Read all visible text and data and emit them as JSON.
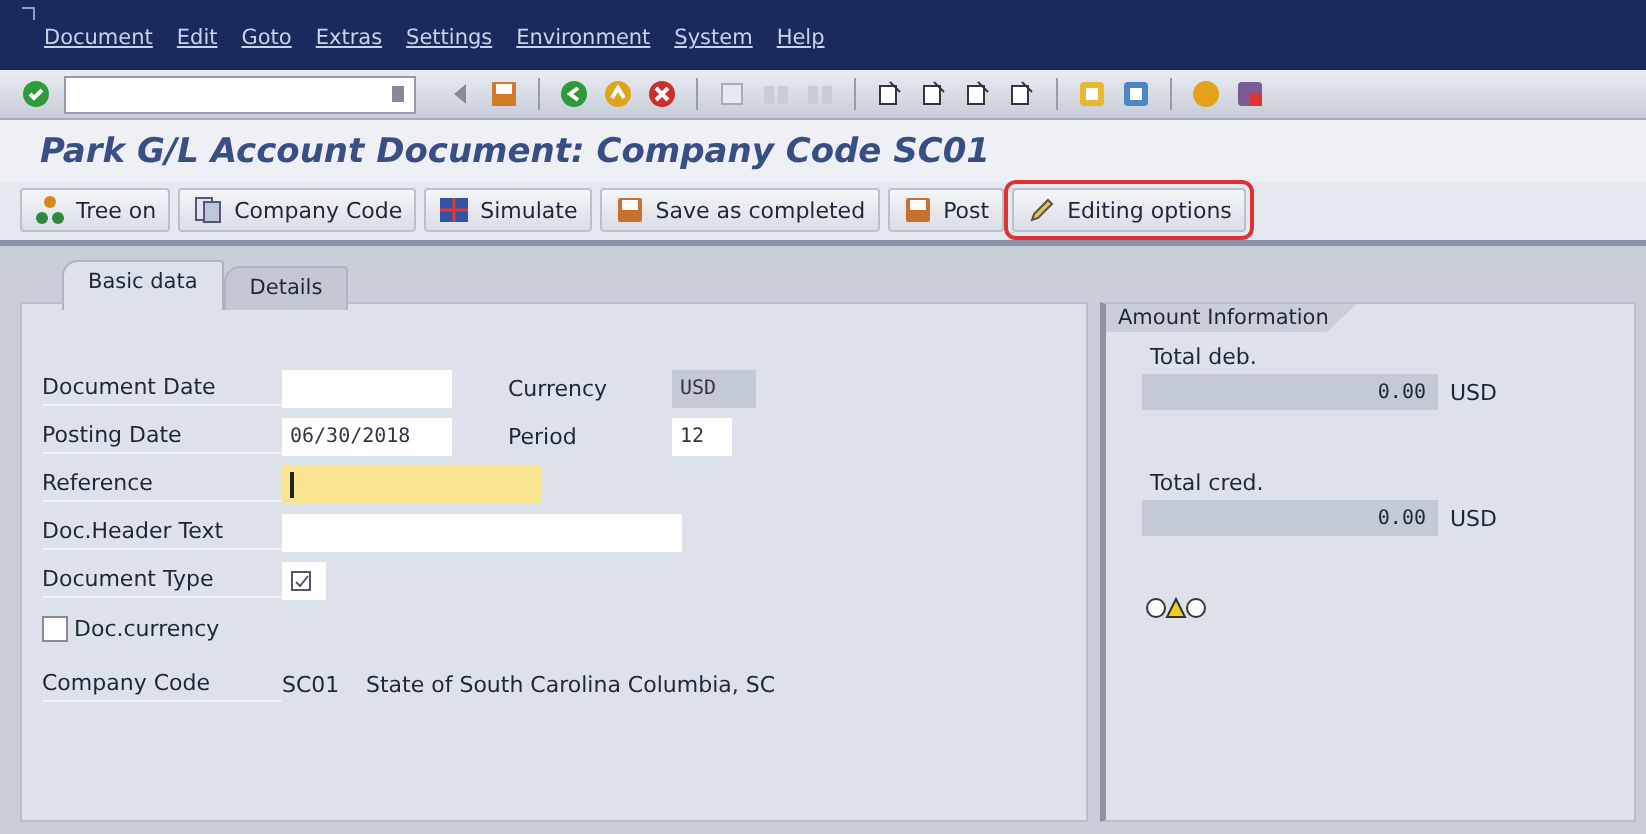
{
  "menu": [
    {
      "label": "Document"
    },
    {
      "label": "Edit"
    },
    {
      "label": "Goto"
    },
    {
      "label": "Extras"
    },
    {
      "label": "Settings"
    },
    {
      "label": "Environment"
    },
    {
      "label": "System"
    },
    {
      "label": "Help"
    }
  ],
  "title": "Park G/L Account Document: Company Code SC01",
  "app_toolbar": [
    {
      "label": "Tree on",
      "kind": "tree",
      "highlighted": false
    },
    {
      "label": "Company Code",
      "kind": "company",
      "highlighted": false
    },
    {
      "label": "Simulate",
      "kind": "simulate",
      "highlighted": false
    },
    {
      "label": "Save as completed",
      "kind": "save",
      "highlighted": false
    },
    {
      "label": "Post",
      "kind": "save",
      "highlighted": false
    },
    {
      "label": "Editing options",
      "kind": "pencil",
      "highlighted": true
    }
  ],
  "tabs": [
    {
      "label": "Basic data",
      "selected": true
    },
    {
      "label": "Details",
      "selected": false
    }
  ],
  "form": [
    {
      "kind": "field",
      "label": "Document Date",
      "focused": false,
      "side": {
        "label": "Currency",
        "value": "USD",
        "disabled": true
      }
    },
    {
      "kind": "field",
      "label": "Posting Date",
      "value": "06/30/2018",
      "focused": false,
      "side": {
        "label": "Period",
        "value": "12",
        "disabled": false
      }
    },
    {
      "kind": "field",
      "label": "Reference",
      "focused": true
    },
    {
      "kind": "field",
      "label": "Doc.Header Text",
      "focused": false
    },
    {
      "kind": "icon-field",
      "label": "Document Type"
    },
    {
      "kind": "checkbox",
      "label": "Doc.currency",
      "checked": false
    },
    {
      "kind": "text",
      "label": "Company Code",
      "value": "SC01",
      "description": "State of South Carolina Columbia, SC"
    }
  ],
  "amount_info": {
    "title": "Amount Information",
    "totals": [
      {
        "label": "Total deb.",
        "value": "0.00",
        "currency": "USD"
      },
      {
        "label": "Total cred.",
        "value": "0.00",
        "currency": "USD"
      }
    ],
    "status_lights": [
      {
        "on": false
      },
      {
        "on": true
      },
      {
        "on": false
      }
    ]
  }
}
